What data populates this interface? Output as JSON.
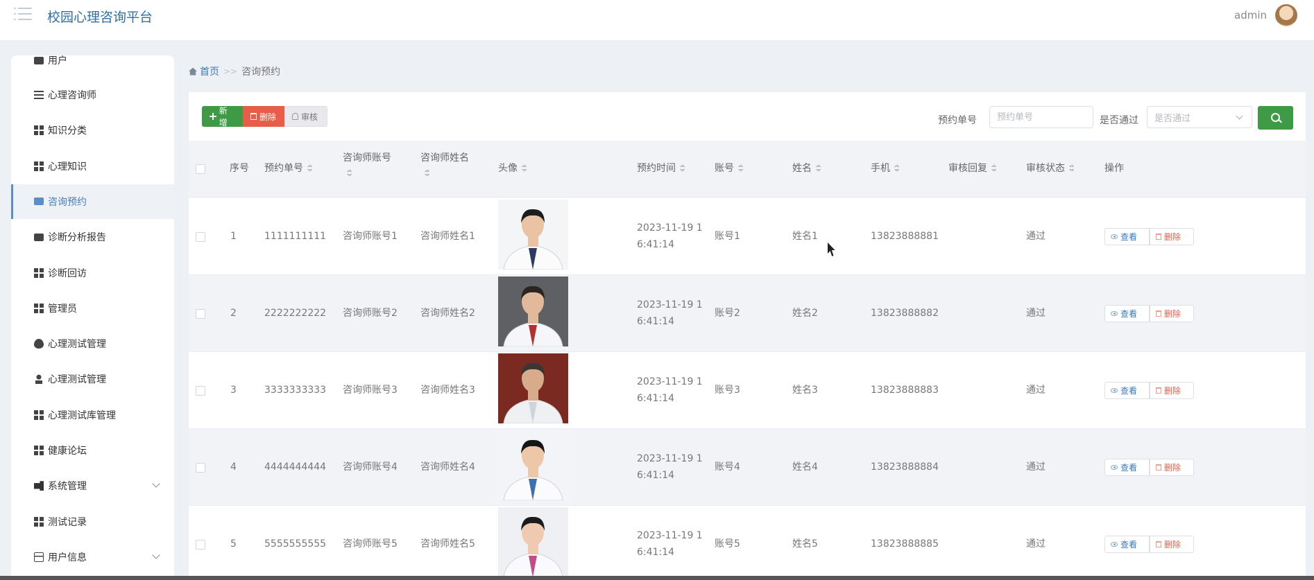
{
  "header": {
    "title": "校园心理咨询平台",
    "username": "admin"
  },
  "sidebar": {
    "partial_top": "用户",
    "items": [
      {
        "label": "心理咨询师",
        "icon": "sliders-icon"
      },
      {
        "label": "知识分类",
        "icon": "grid-icon"
      },
      {
        "label": "心理知识",
        "icon": "grid-icon"
      },
      {
        "label": "咨询预约",
        "icon": "monitor-icon",
        "active": true
      },
      {
        "label": "诊断分析报告",
        "icon": "monitor-icon"
      },
      {
        "label": "诊断回访",
        "icon": "grid-icon"
      },
      {
        "label": "管理员",
        "icon": "grid-icon"
      },
      {
        "label": "心理测试管理",
        "icon": "bulb-icon"
      },
      {
        "label": "心理测试管理",
        "icon": "person-icon"
      },
      {
        "label": "心理测试库管理",
        "icon": "grid-icon"
      },
      {
        "label": "健康论坛",
        "icon": "grid-icon"
      },
      {
        "label": "系统管理",
        "icon": "tools-icon",
        "expandable": true
      },
      {
        "label": "测试记录",
        "icon": "grid-icon"
      },
      {
        "label": "用户信息",
        "icon": "card-icon",
        "expandable": true
      }
    ]
  },
  "breadcrumb": {
    "home": "首页",
    "separator": ">>",
    "current": "咨询预约"
  },
  "toolbar": {
    "add_label": "新增",
    "delete_label": "删除",
    "audit_label": "审核"
  },
  "search": {
    "order_label": "预约单号",
    "order_placeholder": "预约单号",
    "pass_label": "是否通过",
    "pass_placeholder": "是否通过"
  },
  "table": {
    "columns": [
      "序号",
      "预约单号",
      "咨询师账号",
      "咨询师姓名",
      "头像",
      "预约时间",
      "账号",
      "姓名",
      "手机",
      "审核回复",
      "审核状态",
      "操作"
    ],
    "view_label": "查看",
    "delete_label": "删除",
    "rows": [
      {
        "index": "1",
        "order_no": "1111111111",
        "counselor_account": "咨询师账号1",
        "counselor_name": "咨询师姓名1",
        "time_line1": "2023-11-19 1",
        "time_line2": "6:41:14",
        "account": "账号1",
        "name": "姓名1",
        "phone": "13823888881",
        "reply": "",
        "status": "通过"
      },
      {
        "index": "2",
        "order_no": "2222222222",
        "counselor_account": "咨询师账号2",
        "counselor_name": "咨询师姓名2",
        "time_line1": "2023-11-19 1",
        "time_line2": "6:41:14",
        "account": "账号2",
        "name": "姓名2",
        "phone": "13823888882",
        "reply": "",
        "status": "通过"
      },
      {
        "index": "3",
        "order_no": "3333333333",
        "counselor_account": "咨询师账号3",
        "counselor_name": "咨询师姓名3",
        "time_line1": "2023-11-19 1",
        "time_line2": "6:41:14",
        "account": "账号3",
        "name": "姓名3",
        "phone": "13823888883",
        "reply": "",
        "status": "通过"
      },
      {
        "index": "4",
        "order_no": "4444444444",
        "counselor_account": "咨询师账号4",
        "counselor_name": "咨询师姓名4",
        "time_line1": "2023-11-19 1",
        "time_line2": "6:41:14",
        "account": "账号4",
        "name": "姓名4",
        "phone": "13823888884",
        "reply": "",
        "status": "通过"
      },
      {
        "index": "5",
        "order_no": "5555555555",
        "counselor_account": "咨询师账号5",
        "counselor_name": "咨询师姓名5",
        "time_line1": "2023-11-19 1",
        "time_line2": "6:41:14",
        "account": "账号5",
        "name": "姓名5",
        "phone": "13823888885",
        "reply": "",
        "status": "通过"
      }
    ]
  },
  "colors": {
    "brand_title": "#2f6fa6",
    "add_green": "#3e9a45",
    "delete_red": "#e85d48",
    "link_blue": "#3a79b8",
    "active_nav": "#5b8ec4"
  }
}
